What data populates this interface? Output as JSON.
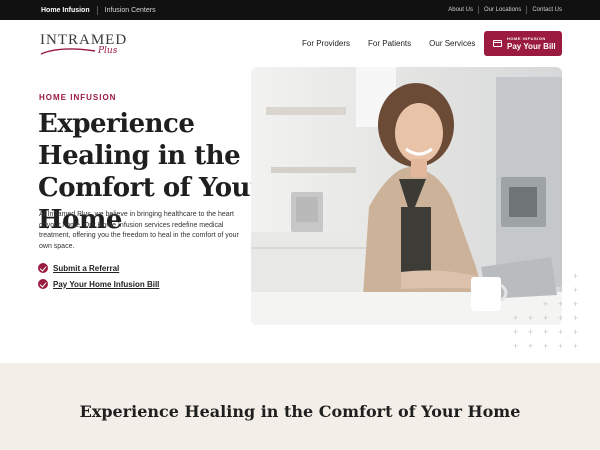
{
  "topbar": {
    "left_links": [
      "Home Infusion",
      "Infusion Centers"
    ],
    "right_links": [
      "About Us",
      "Our Locations",
      "Contact Us"
    ]
  },
  "logo": {
    "main": "INTRAMED",
    "sub": "Plus"
  },
  "nav": {
    "items": [
      "For Providers",
      "For Patients",
      "Our Services"
    ],
    "pay_button": {
      "small": "HOME INFUSION",
      "big": "Pay Your Bill",
      "icon": "credit-card-icon"
    }
  },
  "hero": {
    "eyebrow": "HOME INFUSION",
    "title": "Experience Healing in the Comfort of Your Home",
    "description": "At Intramed Plus, we believe in bringing healthcare to the heart of your home. Our Home Infusion services redefine medical treatment, offering you the freedom to heal in the comfort of your own space.",
    "ctas": [
      "Submit a Referral",
      "Pay Your Home Infusion Bill"
    ]
  },
  "section2": {
    "title": "Experience Healing in the Comfort of Your Home"
  },
  "colors": {
    "brand": "#9a1b3f",
    "topbar": "#111111",
    "section_bg": "#f3efe8"
  }
}
